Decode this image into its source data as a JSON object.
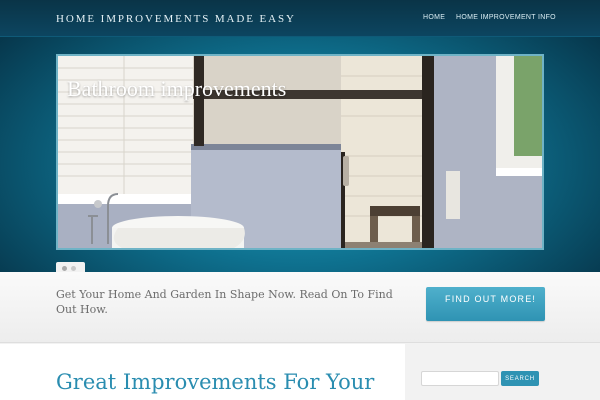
{
  "header": {
    "site_title": "HOME IMPROVEMENTS MADE EASY",
    "nav": [
      "HOME",
      "HOME IMPROVEMENT INFO"
    ]
  },
  "slider": {
    "caption": "Bathroom improvements",
    "slide_count": 2,
    "active_slide": 1
  },
  "cta": {
    "text": "Get Your Home And Garden In Shape Now. Read On To Find Out How.",
    "button_label": "FIND OUT MORE!"
  },
  "content": {
    "heading": "Great Improvements For Your"
  },
  "sidebar": {
    "search_value": "",
    "search_button": "SEARCH"
  },
  "colors": {
    "accent": "#2f93b3",
    "hero_dark": "#073c52",
    "hero_light": "#1fa8c8"
  }
}
